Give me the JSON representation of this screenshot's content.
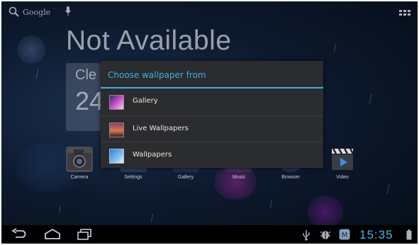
{
  "topbar": {
    "search_text": "Google"
  },
  "widget": {
    "title": "Not Available",
    "line1": "Cle",
    "line2": "24"
  },
  "dock": {
    "items": [
      {
        "label": "Camera"
      },
      {
        "label": "Settings"
      },
      {
        "label": "Gallery"
      },
      {
        "label": "Music"
      },
      {
        "label": "Browser"
      },
      {
        "label": "Video"
      }
    ]
  },
  "dialog": {
    "title": "Choose wallpaper from",
    "options": [
      {
        "label": "Gallery",
        "icon": "gallery-icon"
      },
      {
        "label": "Live Wallpapers",
        "icon": "live-wallpapers-icon"
      },
      {
        "label": "Wallpapers",
        "icon": "wallpapers-icon"
      }
    ]
  },
  "statusbar": {
    "time": "15:35"
  },
  "colors": {
    "accent": "#3bb1e5",
    "dialog_bg": "#2b2c2e",
    "navbar_bg": "#000000"
  }
}
